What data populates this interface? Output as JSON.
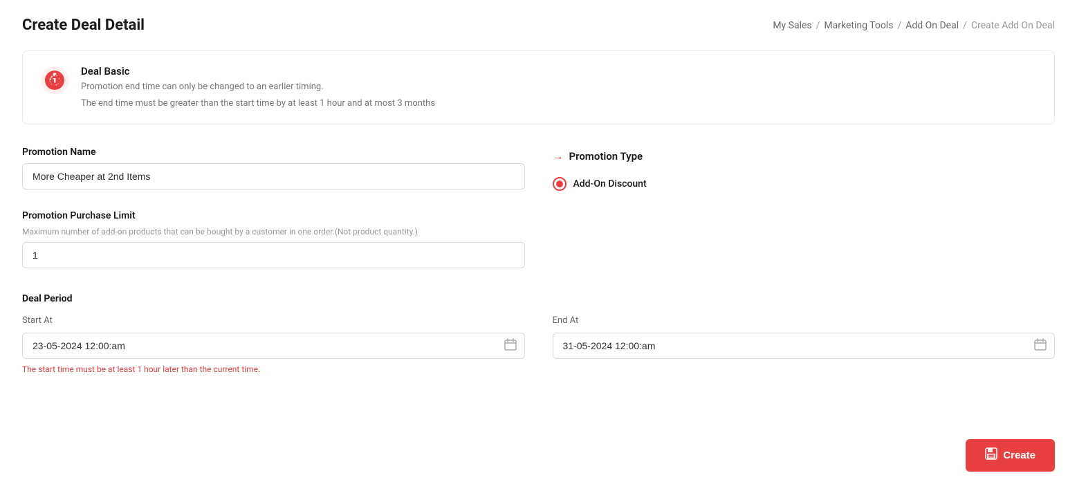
{
  "page": {
    "title": "Create Deal Detail"
  },
  "breadcrumb": {
    "items": [
      {
        "label": "My Sales",
        "active": false
      },
      {
        "label": "Marketing Tools",
        "active": false
      },
      {
        "label": "Add On Deal",
        "active": false
      },
      {
        "label": "Create Add On Deal",
        "active": true
      }
    ],
    "separator": "/"
  },
  "info_box": {
    "title": "Deal Basic",
    "line1": "Promotion end time can only be changed to an earlier timing.",
    "line2": "The end time must be greater than the start time by at least 1 hour and at most 3 months"
  },
  "form": {
    "promotion_name": {
      "label": "Promotion Name",
      "value": "More Cheaper at 2nd Items",
      "placeholder": ""
    },
    "promotion_purchase_limit": {
      "label": "Promotion Purchase Limit",
      "sublabel": "Maximum number of add-on products that can be bought by a customer in one order.(Not product quantity.)",
      "value": "1"
    },
    "promotion_type": {
      "label": "Promotion Type",
      "options": [
        {
          "label": "Add-On Discount",
          "selected": true
        }
      ]
    },
    "deal_period": {
      "label": "Deal Period",
      "start_at": {
        "label": "Start At",
        "value": "23-05-2024 12:00:am"
      },
      "end_at": {
        "label": "End At",
        "value": "31-05-2024 12:00:am"
      },
      "error_text": "The start time must be at least 1 hour later than the current time."
    }
  },
  "buttons": {
    "create": "Create"
  }
}
